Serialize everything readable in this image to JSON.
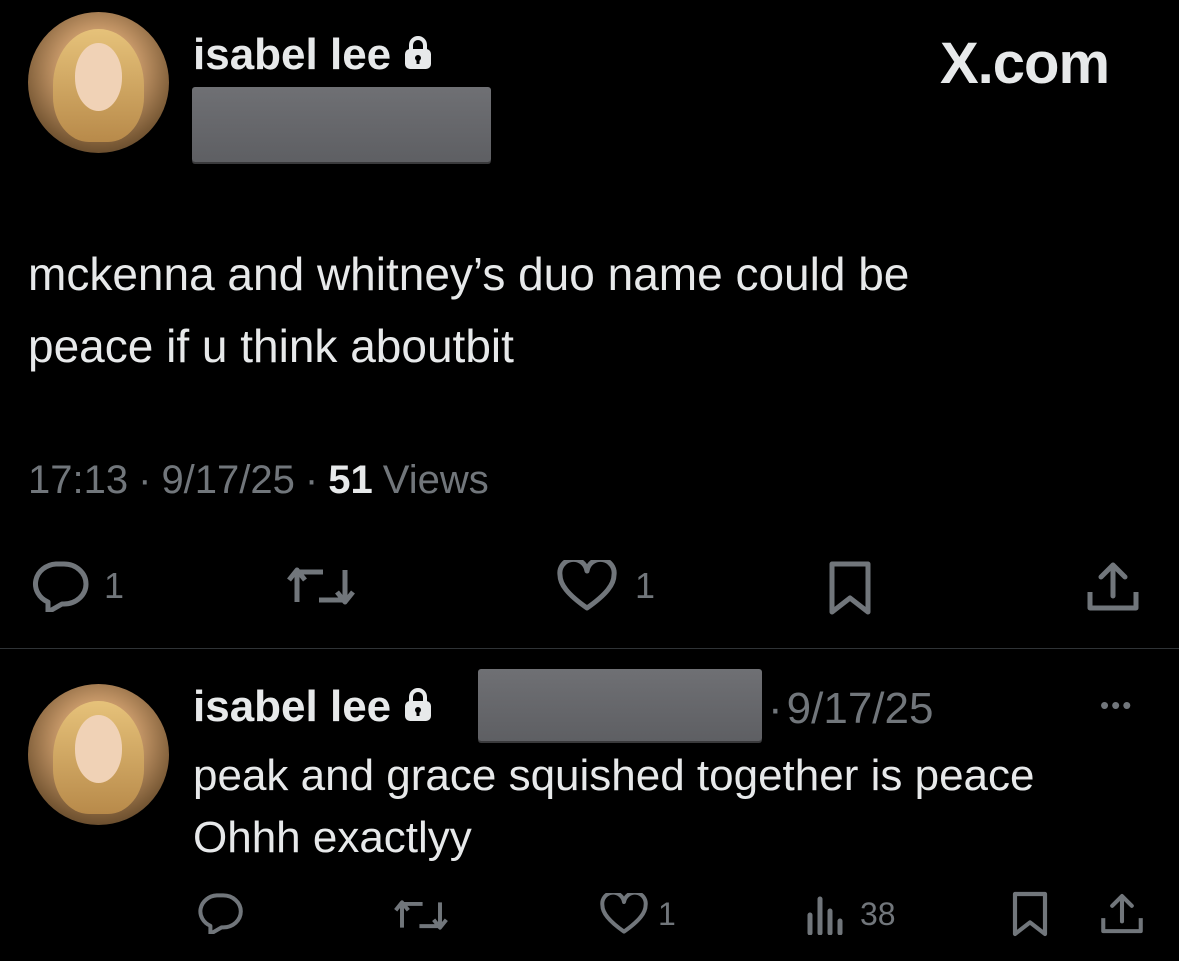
{
  "watermark": "X.com",
  "main_tweet": {
    "author": "isabel lee",
    "body_line1": "mckenna and whitney’s duo name could be",
    "body_line2": "peace if u think aboutbit",
    "time": "17:13",
    "sep1": "·",
    "date": "9/17/25",
    "sep2": "·",
    "views_count": "51",
    "views_label": "Views",
    "actions": {
      "reply_count": "1",
      "like_count": "1",
      "icons": [
        "reply-icon",
        "retweet-icon",
        "like-icon",
        "bookmark-icon",
        "share-icon"
      ]
    }
  },
  "reply_tweet": {
    "author": "isabel lee",
    "sep": "·",
    "date": "9/17/25",
    "more": "•••",
    "line1": "peak and grace squished together is peace",
    "line2": "Ohhh exactlyy",
    "actions": {
      "like_count": "1",
      "views_count": "38"
    }
  },
  "colors": {
    "background": "#000000",
    "text": "#e7e9ea",
    "muted": "#71767b",
    "divider": "#2f3336"
  }
}
